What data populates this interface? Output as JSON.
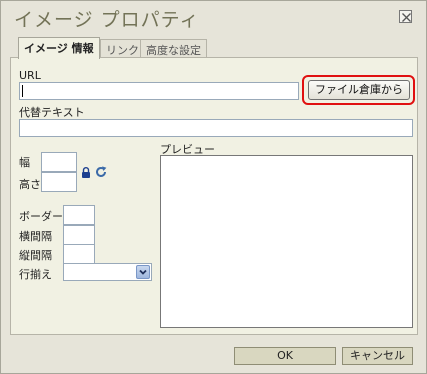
{
  "dialog": {
    "title": "イメージ プロパティ",
    "close_icon": "close-icon"
  },
  "tabs": [
    {
      "label": "イメージ 情報",
      "active": true
    },
    {
      "label": "リンク",
      "active": false
    },
    {
      "label": "高度な設定",
      "active": false
    }
  ],
  "form": {
    "url_label": "URL",
    "url_value": "",
    "browse_label": "ファイル倉庫から",
    "alt_label": "代替テキスト",
    "alt_value": "",
    "width_label": "幅",
    "height_label": "高さ",
    "border_label": "ボーダー",
    "hspace_label": "横間隔",
    "vspace_label": "縦間隔",
    "align_label": "行揃え",
    "align_value": "",
    "lock_icon": "lock-icon",
    "reset_icon": "reset-size-icon",
    "preview_label": "プレビュー"
  },
  "footer": {
    "ok_label": "OK",
    "cancel_label": "キャンセル"
  },
  "colors": {
    "dialog_bg": "#e6e4d9",
    "panel_bg": "#f1f1e3",
    "title_color": "#737357",
    "highlight": "#e01010"
  }
}
